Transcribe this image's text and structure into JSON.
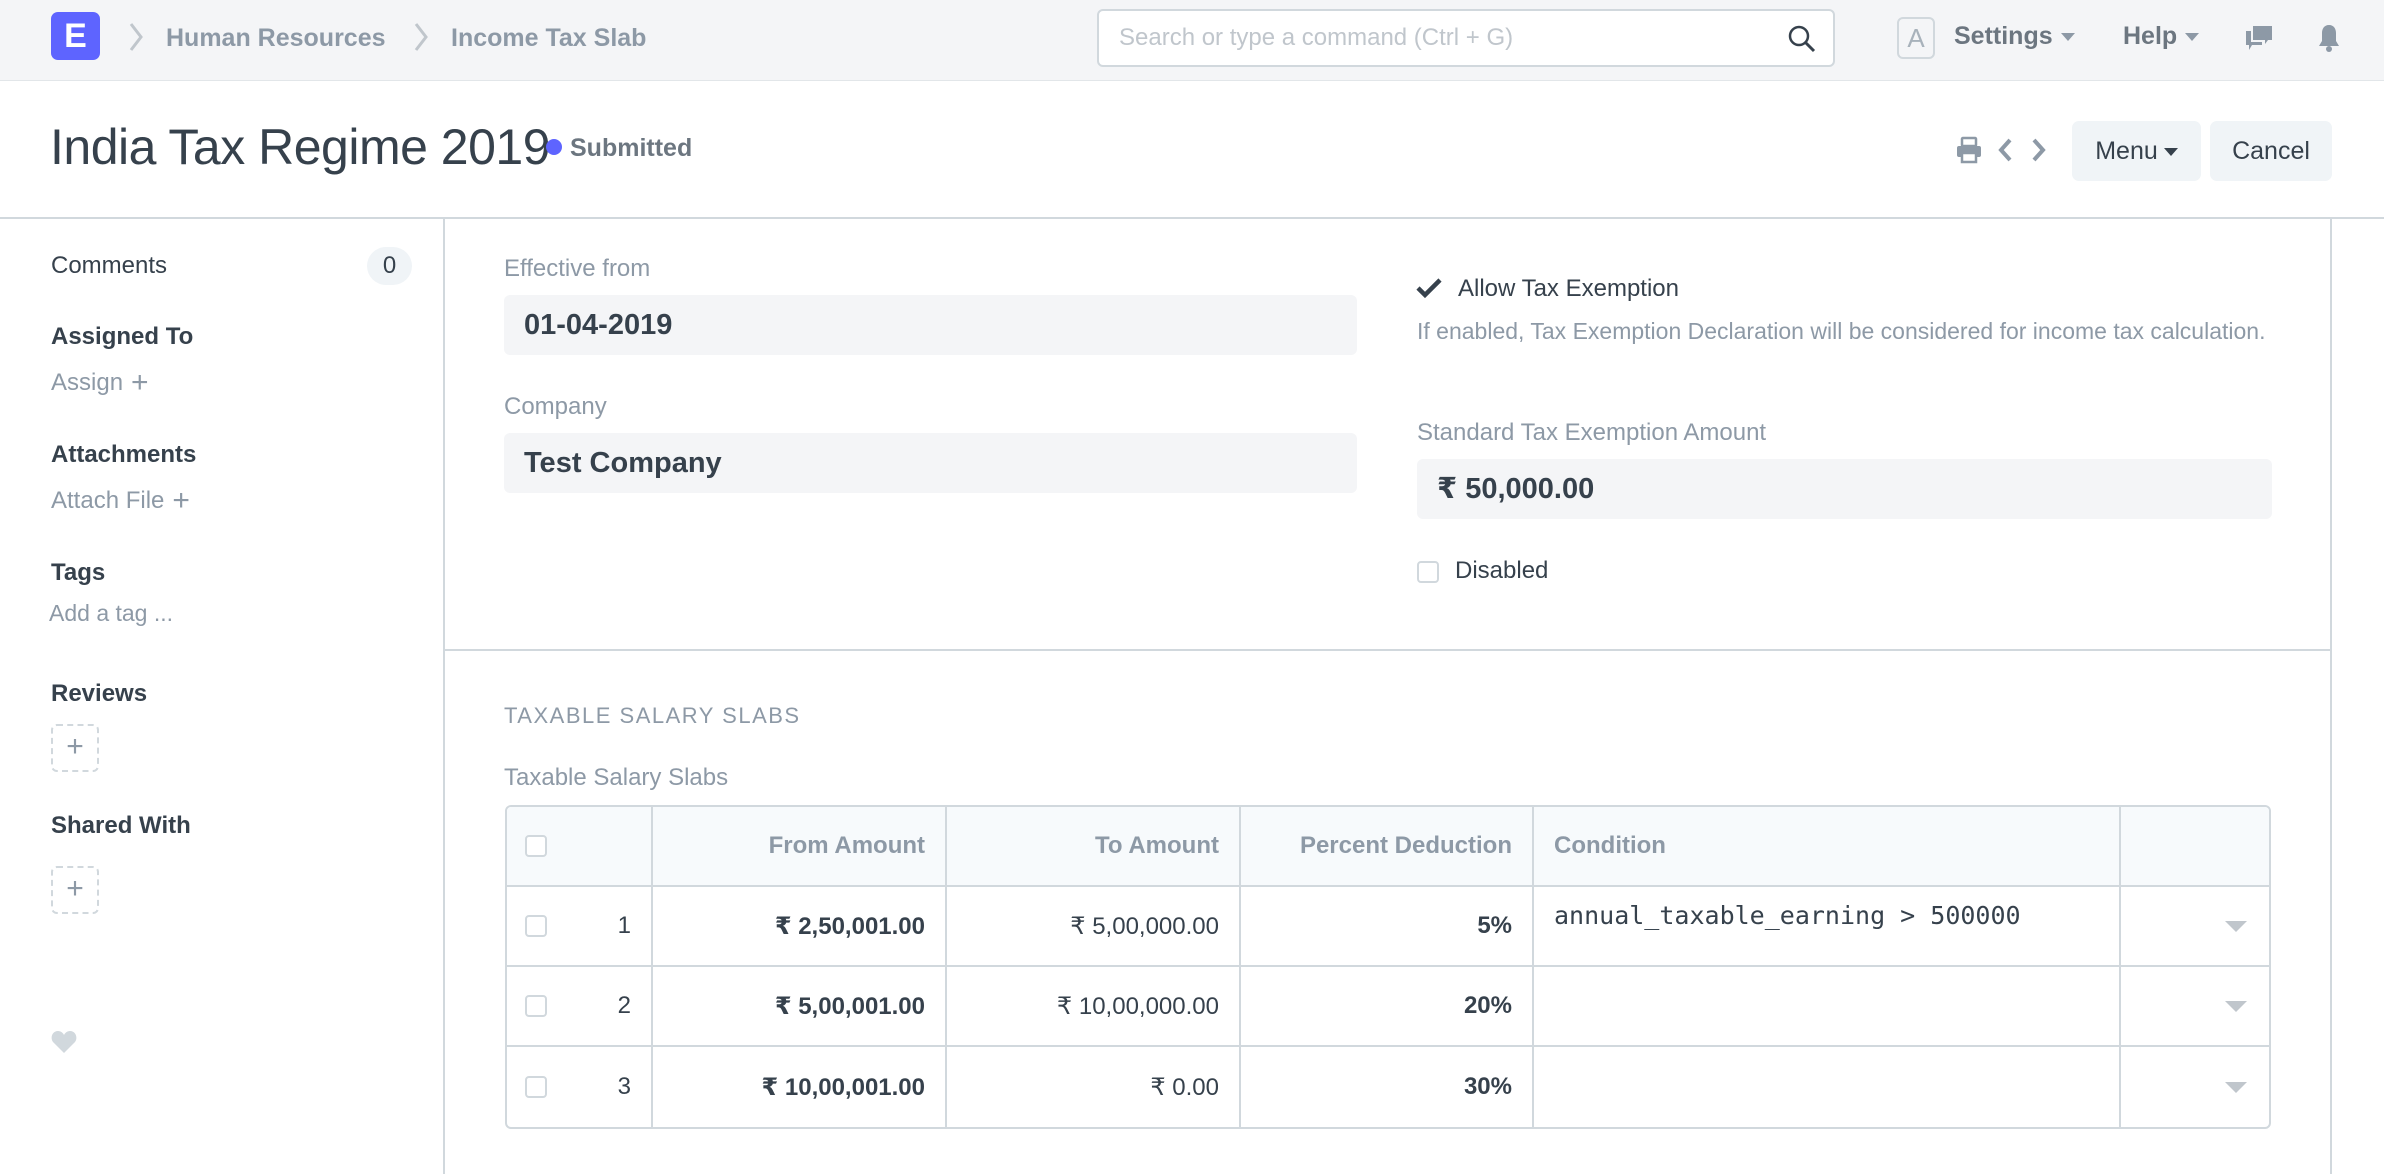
{
  "navbar": {
    "logo_letter": "E",
    "breadcrumbs": [
      "Human Resources",
      "Income Tax Slab"
    ],
    "search_placeholder": "Search or type a command (Ctrl + G)",
    "avatar_letter": "A",
    "settings_label": "Settings",
    "help_label": "Help",
    "icons": [
      "chat-icon",
      "bell-icon"
    ]
  },
  "page_head": {
    "title": "India Tax Regime 2019",
    "status": "Submitted",
    "status_color": "#5e64ff",
    "menu_label": "Menu",
    "cancel_label": "Cancel"
  },
  "sidebar": {
    "comments_label": "Comments",
    "comments_count": "0",
    "assigned_to_label": "Assigned To",
    "assign_label": "Assign",
    "attachments_label": "Attachments",
    "attach_file_label": "Attach File",
    "tags_label": "Tags",
    "add_tag_label": "Add a tag ...",
    "reviews_label": "Reviews",
    "shared_with_label": "Shared With",
    "plus": "+"
  },
  "form": {
    "effective_from_label": "Effective from",
    "effective_from_value": "01-04-2019",
    "company_label": "Company",
    "company_value": "Test Company",
    "allow_tax_exemption_label": "Allow Tax Exemption",
    "allow_tax_exemption_checked": true,
    "allow_tax_exemption_desc": "If enabled, Tax Exemption Declaration will be considered for income tax calculation.",
    "standard_exemption_label": "Standard Tax Exemption Amount",
    "standard_exemption_value": "₹ 50,000.00",
    "disabled_label": "Disabled",
    "disabled_checked": false,
    "section_title": "TAXABLE SALARY SLABS",
    "table_label": "Taxable Salary Slabs"
  },
  "table": {
    "headers": {
      "from": "From Amount",
      "to": "To Amount",
      "percent": "Percent Deduction",
      "condition": "Condition"
    },
    "rows": [
      {
        "idx": "1",
        "from": "₹ 2,50,001.00",
        "to": "₹ 5,00,000.00",
        "percent": "5%",
        "condition": "annual_taxable_earning > 500000"
      },
      {
        "idx": "2",
        "from": "₹ 5,00,001.00",
        "to": "₹ 10,00,000.00",
        "percent": "20%",
        "condition": ""
      },
      {
        "idx": "3",
        "from": "₹ 10,00,001.00",
        "to": "₹ 0.00",
        "percent": "30%",
        "condition": ""
      }
    ]
  }
}
